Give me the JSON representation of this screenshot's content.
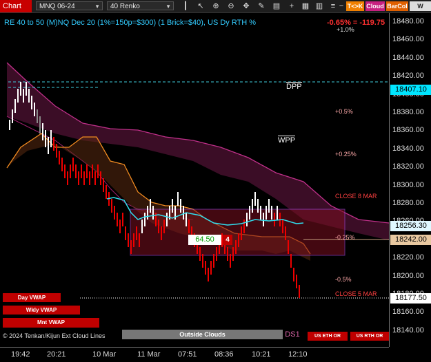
{
  "toolbar": {
    "title": "Chart",
    "instrument": "MNQ 06-24",
    "bar_type": "40 Renko",
    "pills": [
      {
        "label": "T<>K",
        "color": "#f08000"
      },
      {
        "label": "Cloud",
        "color": "#c82080"
      },
      {
        "label": "BarCol",
        "color": "#e06000"
      },
      {
        "label": "W VWA",
        "color": "#dddddd"
      }
    ],
    "icons": [
      "bars-icon",
      "cursor-icon",
      "zoom-in-icon",
      "zoom-out-icon",
      "scroll-icon",
      "drawing-icon",
      "properties-icon",
      "plus-icon",
      "data-box-icon",
      "chart-style-icon",
      "template-icon",
      "share-icon",
      "minus-icon"
    ]
  },
  "chart": {
    "title": "RE 40 to 50 (M)NQ Dec 20 (1%=150p=$300) (1 Brick=$40), US Dy RTH %",
    "change": "-0.65% = -119.75",
    "levels": {
      "dpp": "DPP",
      "wpp": "WPP"
    },
    "pct_labels": [
      {
        "text": "+1.0%",
        "color": "#dddddd"
      },
      {
        "text": "+0.5%",
        "color": "#ffaaaa"
      },
      {
        "text": "+0.25%",
        "color": "#ffaaaa"
      },
      {
        "text": "CLOSE 8 MAR",
        "color": "#ff4040"
      },
      {
        "text": "-0.25%",
        "color": "#ffaaaa"
      },
      {
        "text": "-0.5%",
        "color": "#ffaaaa"
      },
      {
        "text": "CLOSE 5 MAR",
        "color": "#ff4040"
      }
    ],
    "box_label": "64.50",
    "box_count": "4",
    "vwap_buttons": [
      "Day VWAP",
      "Wkly VWAP",
      "Mnt VWAP"
    ],
    "legend": "© 2024 Tenkan/Kijun Ext Cloud Lines",
    "outside_clouds": "Outside Clouds",
    "ds_label": "DS1",
    "eth_button": "US ETH OR",
    "rth_button": "US RTH OR"
  },
  "price_axis": {
    "ticks": [
      "18480.00",
      "18460.00",
      "18440.00",
      "18420.00",
      "18400.00",
      "18380.00",
      "18360.00",
      "18340.00",
      "18320.00",
      "18300.00",
      "18280.00",
      "18260.00",
      "18240.00",
      "18220.00",
      "18200.00",
      "18180.00",
      "18160.00",
      "18140.00"
    ],
    "tags": [
      {
        "text": "18407.10",
        "bg": "#00e5ff",
        "fg": "#000000"
      },
      {
        "text": "18256.30",
        "bg": "#e0f8ff",
        "fg": "#000000"
      },
      {
        "text": "18242.00",
        "bg": "#e8c8a0",
        "fg": "#000000"
      },
      {
        "text": "18177.50",
        "bg": "#ffffff",
        "fg": "#000000"
      }
    ]
  },
  "time_axis": {
    "labels": [
      "19:42",
      "20:21",
      "10 Mar",
      "11 Mar",
      "07:51",
      "08:36",
      "10:21",
      "12:10"
    ]
  },
  "chart_data": {
    "type": "bar",
    "ylim": [
      18130,
      18490
    ],
    "price_tags": [
      18407.1,
      18256.3,
      18242.0,
      18177.5
    ]
  }
}
